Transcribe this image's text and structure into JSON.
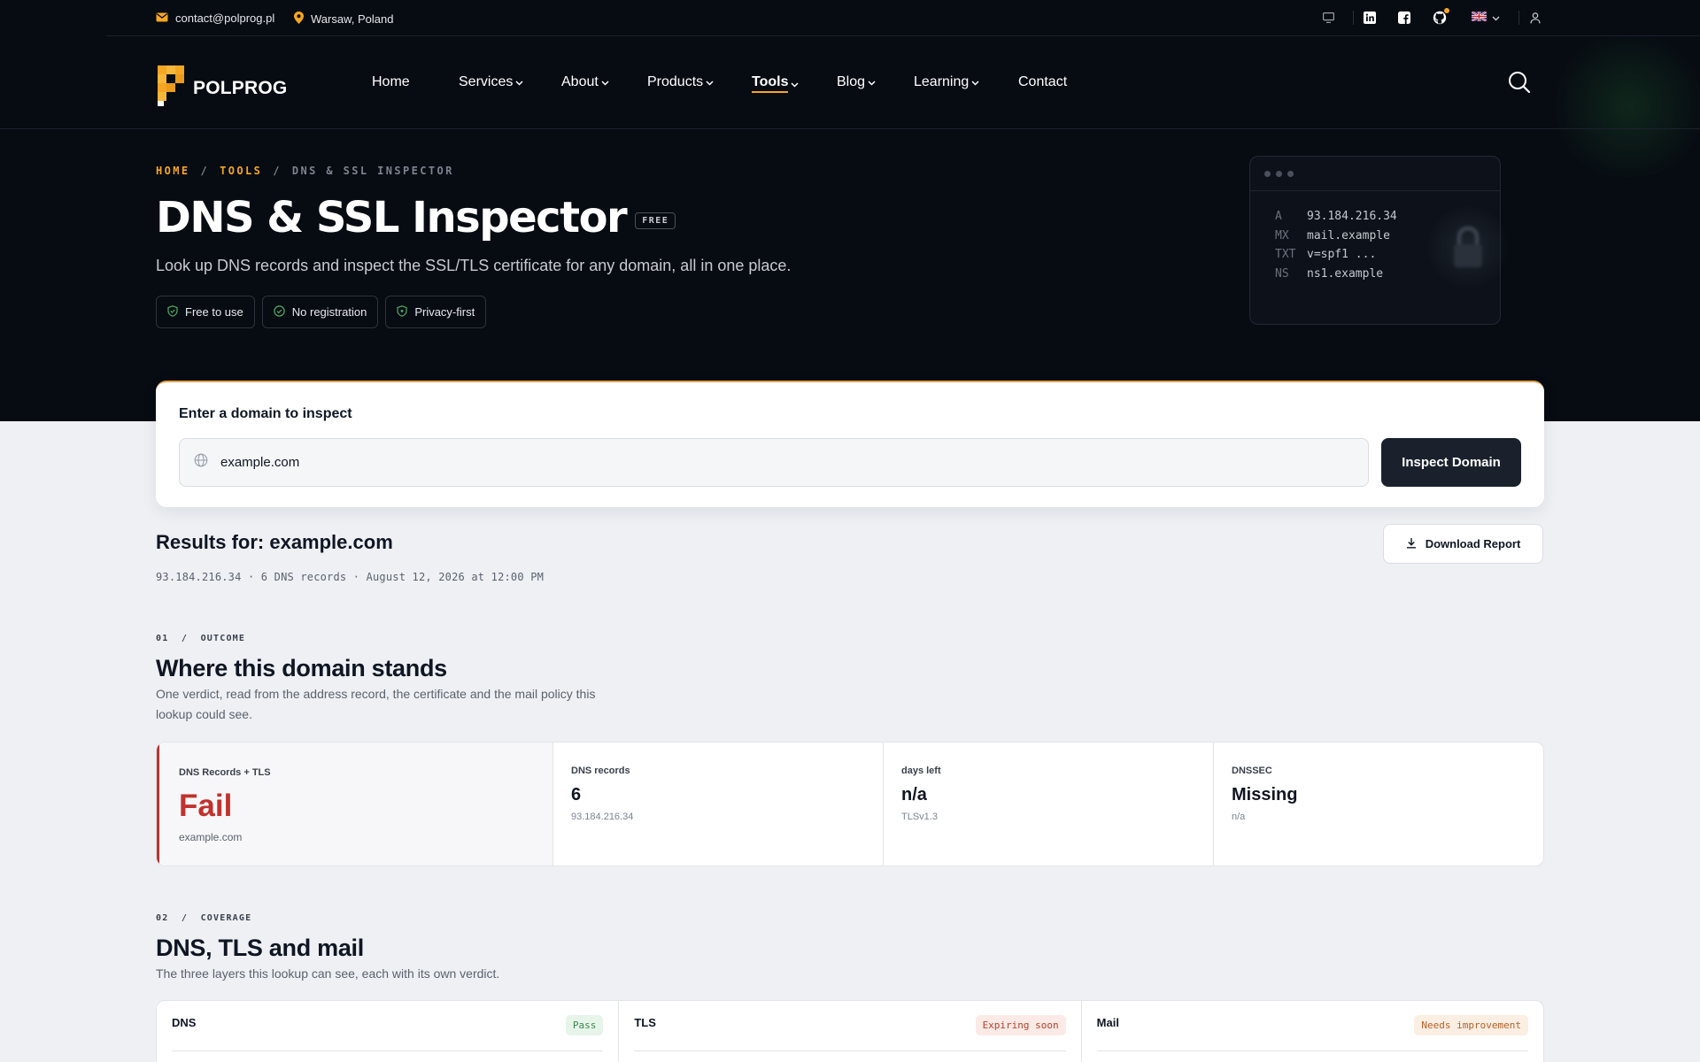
{
  "topbar": {
    "email": "contact@polprog.pl",
    "location": "Warsaw, Poland"
  },
  "nav": {
    "logo_text": "POLPROG",
    "items": [
      {
        "label": "Home"
      },
      {
        "label": "Services"
      },
      {
        "label": "About"
      },
      {
        "label": "Products"
      },
      {
        "label": "Tools"
      },
      {
        "label": "Blog"
      },
      {
        "label": "Learning"
      },
      {
        "label": "Contact"
      }
    ]
  },
  "breadcrumb": {
    "home": "HOME",
    "tools": "TOOLS",
    "current": "DNS & SSL INSPECTOR",
    "sep": "/"
  },
  "hero": {
    "title": "DNS & SSL Inspector",
    "badge": "FREE",
    "subtitle": "Look up DNS records and inspect the SSL/TLS certificate for any domain, all in one place.",
    "chips": [
      "Free to use",
      "No registration",
      "Privacy-first"
    ]
  },
  "terminal": {
    "rows": [
      {
        "k": "A",
        "v": "93.184.216.34"
      },
      {
        "k": "MX",
        "v": "mail.example"
      },
      {
        "k": "TXT",
        "v": "v=spf1 ..."
      },
      {
        "k": "NS",
        "v": "ns1.example"
      }
    ]
  },
  "search": {
    "label": "Enter a domain to inspect",
    "value": "example.com",
    "button": "Inspect Domain"
  },
  "results": {
    "title": "Results for: example.com",
    "meta": "93.184.216.34 · 6 DNS records · August 12, 2026 at 12:00 PM",
    "download": "Download Report"
  },
  "outcome": {
    "eyebrow_num": "01",
    "eyebrow": "OUTCOME",
    "title": "Where this domain stands",
    "desc_1": "One verdict, read from the address record, the certificate and the mail policy this",
    "desc_2": "lookup could see.",
    "verdict": {
      "label": "DNS Records + TLS",
      "value": "Fail",
      "sub": "example.com"
    },
    "metrics": [
      {
        "label": "DNS records",
        "value": "6",
        "sub": "93.184.216.34"
      },
      {
        "label": "days left",
        "value": "n/a",
        "sub": "TLSv1.3"
      },
      {
        "label": "DNSSEC",
        "value": "Missing",
        "sub": "n/a"
      }
    ]
  },
  "coverage": {
    "eyebrow_num": "02",
    "eyebrow": "COVERAGE",
    "title": "DNS, TLS and mail",
    "desc": "The three layers this lookup can see, each with its own verdict.",
    "cells": [
      {
        "name": "DNS",
        "badge": "Pass"
      },
      {
        "name": "TLS",
        "badge": "Expiring soon"
      },
      {
        "name": "Mail",
        "badge": "Needs improvement"
      }
    ]
  },
  "colors": {
    "accent": "#f5a623",
    "fail": "#c0322e",
    "dark_bg": "#070b12"
  }
}
